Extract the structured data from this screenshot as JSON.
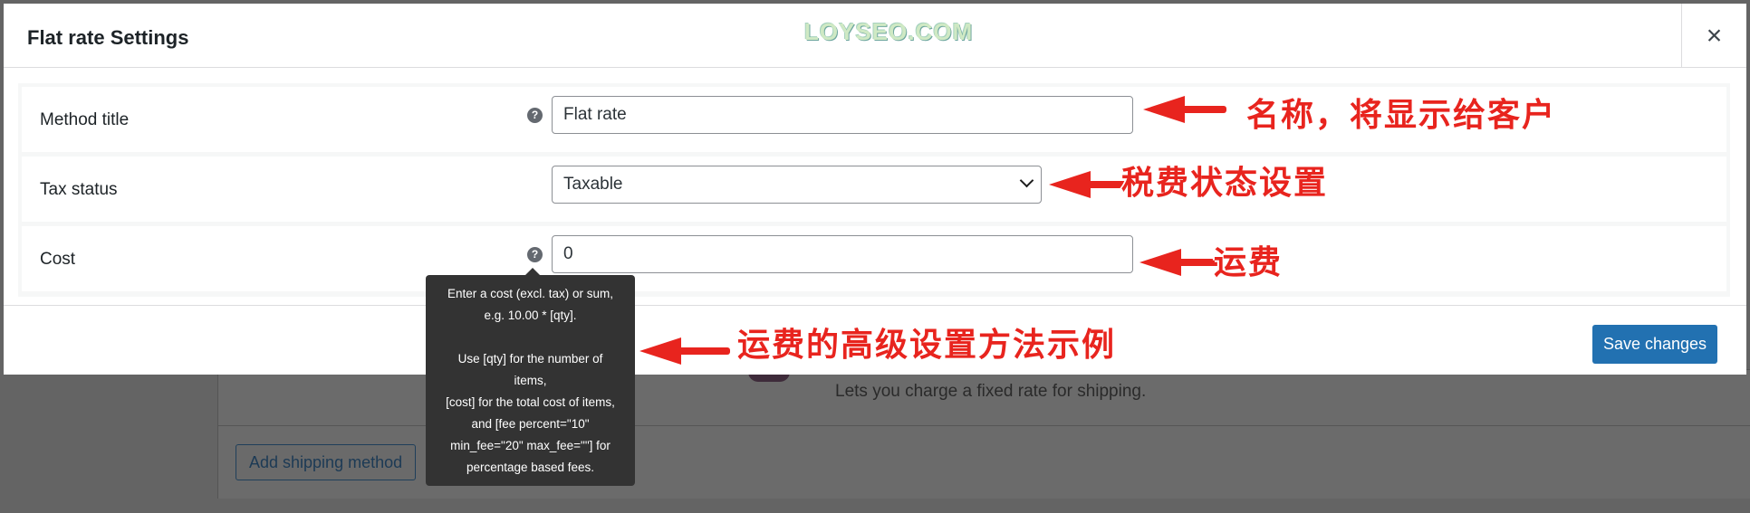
{
  "background": {
    "description": "Lets you charge a fixed rate for shipping.",
    "add_button": "Add shipping method"
  },
  "modal": {
    "title": "Flat rate Settings",
    "close_symbol": "×",
    "watermark": "LOYSEO.COM",
    "fields": {
      "method_title": {
        "label": "Method title",
        "value": "Flat rate"
      },
      "tax_status": {
        "label": "Tax status",
        "value": "Taxable"
      },
      "cost": {
        "label": "Cost",
        "value": "0"
      }
    },
    "save_label": "Save changes"
  },
  "tooltip": {
    "lines": [
      "Enter a cost (excl. tax) or sum,",
      "e.g. 10.00 * [qty].",
      "",
      "Use [qty] for the number of",
      "items,",
      "[cost] for the total cost of items,",
      "and [fee percent=\"10\"",
      "min_fee=\"20\" max_fee=\"\"] for",
      "percentage based fees."
    ]
  },
  "annotations": {
    "method_title": "名称，将显示给客户",
    "tax_status": "税费状态设置",
    "cost": "运费",
    "advanced": "运费的高级设置方法示例"
  },
  "colors": {
    "accent": "#2271b1",
    "annotation": "#e8241e",
    "tooltip_bg": "#333333"
  }
}
